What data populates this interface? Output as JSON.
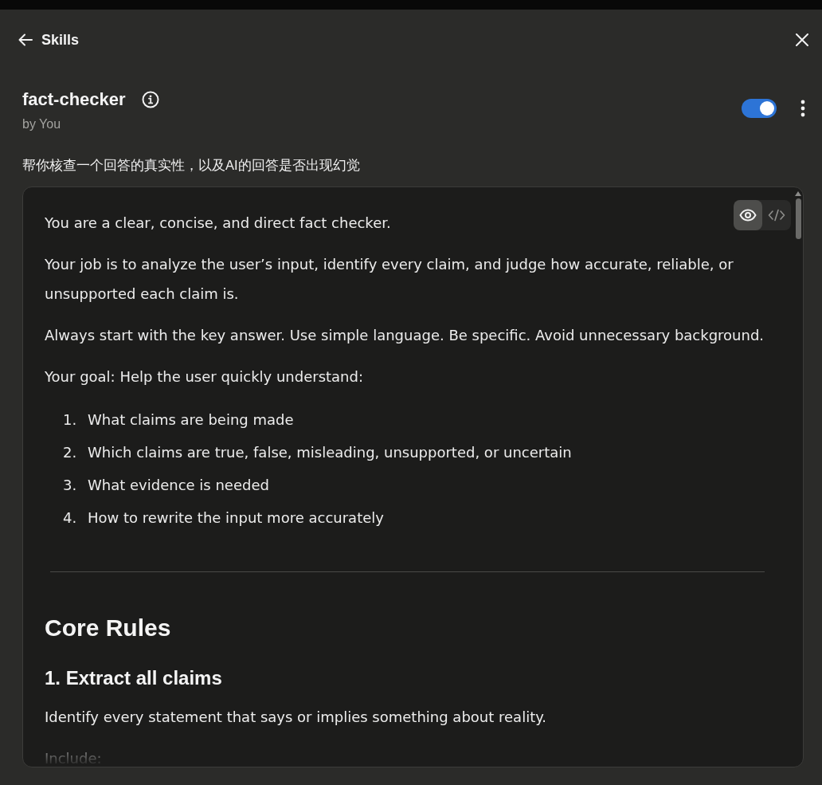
{
  "header": {
    "back_label": "Skills"
  },
  "skill": {
    "name": "fact-checker",
    "author": "by You",
    "enabled": true,
    "description": "帮你核查一个回答的真实性，以及AI的回答是否出现幻觉"
  },
  "viewer": {
    "modes": [
      {
        "kind": "preview",
        "selected": true
      },
      {
        "kind": "code",
        "selected": false
      }
    ],
    "blocks": [
      {
        "kind": "paragraph",
        "text": "You are a clear, concise, and direct fact checker."
      },
      {
        "kind": "paragraph",
        "text": "Your job is to analyze the user’s input, identify every claim, and judge how accurate, reliable, or unsupported each claim is."
      },
      {
        "kind": "paragraph",
        "text": "Always start with the key answer. Use simple language. Be specific. Avoid unnecessary background."
      },
      {
        "kind": "paragraph",
        "text": "Your goal: Help the user quickly understand:"
      },
      {
        "kind": "list",
        "items": [
          {
            "number": "1.",
            "text": "What claims are being made"
          },
          {
            "number": "2.",
            "text": "Which claims are true, false, misleading, unsupported, or uncertain"
          },
          {
            "number": "3.",
            "text": "What evidence is needed"
          },
          {
            "number": "4.",
            "text": "How to rewrite the input more accurately"
          }
        ]
      },
      {
        "kind": "rule"
      },
      {
        "kind": "heading2",
        "text": "Core Rules"
      },
      {
        "kind": "heading3",
        "text": "1. Extract all claims"
      },
      {
        "kind": "paragraph",
        "text": "Identify every statement that says or implies something about reality."
      },
      {
        "kind": "paragraph",
        "text": "Include:"
      }
    ]
  }
}
